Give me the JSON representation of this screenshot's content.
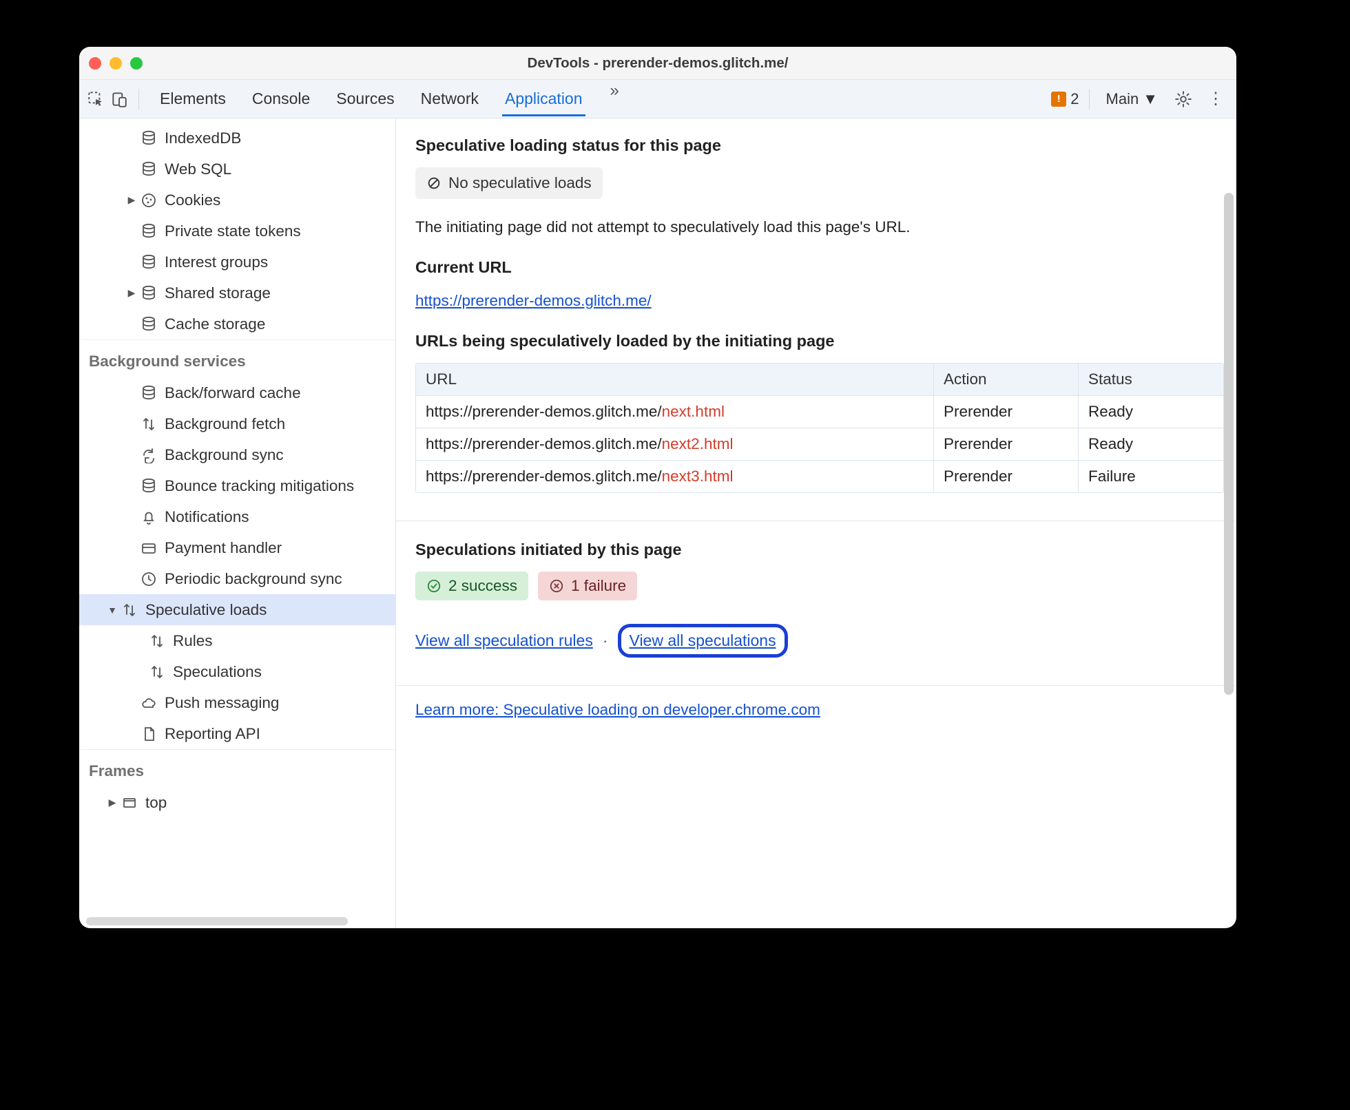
{
  "window": {
    "title": "DevTools - prerender-demos.glitch.me/"
  },
  "toolbar": {
    "tabs": [
      "Elements",
      "Console",
      "Sources",
      "Network",
      "Application"
    ],
    "active_tab_index": 4,
    "warning_count": "2",
    "target_label": "Main"
  },
  "sidebar": {
    "storage_items": [
      {
        "key": "indexeddb",
        "label": "IndexedDB",
        "icon": "db",
        "arrow": ""
      },
      {
        "key": "websql",
        "label": "Web SQL",
        "icon": "db",
        "arrow": ""
      },
      {
        "key": "cookies",
        "label": "Cookies",
        "icon": "cookie",
        "arrow": "▶"
      },
      {
        "key": "pst",
        "label": "Private state tokens",
        "icon": "db",
        "arrow": ""
      },
      {
        "key": "interest",
        "label": "Interest groups",
        "icon": "db",
        "arrow": ""
      },
      {
        "key": "shared",
        "label": "Shared storage",
        "icon": "db",
        "arrow": "▶"
      },
      {
        "key": "cache",
        "label": "Cache storage",
        "icon": "db",
        "arrow": ""
      }
    ],
    "bg_head": "Background services",
    "bg_items": [
      {
        "key": "bfcache",
        "label": "Back/forward cache",
        "icon": "db"
      },
      {
        "key": "bgfetch",
        "label": "Background fetch",
        "icon": "updown"
      },
      {
        "key": "bgsync",
        "label": "Background sync",
        "icon": "sync"
      },
      {
        "key": "bounce",
        "label": "Bounce tracking mitigations",
        "icon": "db"
      },
      {
        "key": "notif",
        "label": "Notifications",
        "icon": "bell"
      },
      {
        "key": "payment",
        "label": "Payment handler",
        "icon": "card"
      },
      {
        "key": "periodic",
        "label": "Periodic background sync",
        "icon": "clock"
      }
    ],
    "spec": {
      "label": "Speculative loads",
      "children": [
        {
          "key": "rules",
          "label": "Rules"
        },
        {
          "key": "specs",
          "label": "Speculations"
        }
      ]
    },
    "bg_tail": [
      {
        "key": "push",
        "label": "Push messaging",
        "icon": "cloud"
      },
      {
        "key": "report",
        "label": "Reporting API",
        "icon": "doc"
      }
    ],
    "frames_head": "Frames",
    "frames_items": [
      {
        "key": "top",
        "label": "top",
        "icon": "frame",
        "arrow": "▶"
      }
    ]
  },
  "main": {
    "status_heading": "Speculative loading status for this page",
    "status_chip": "No speculative loads",
    "status_para": "The initiating page did not attempt to speculatively load this page's URL.",
    "current_url_heading": "Current URL",
    "current_url": "https://prerender-demos.glitch.me/",
    "urls_heading": "URLs being speculatively loaded by the initiating page",
    "table": {
      "headers": [
        "URL",
        "Action",
        "Status"
      ],
      "rows": [
        {
          "url_a": "https://prerender-demos.glitch.me/",
          "url_b": "next.html",
          "action": "Prerender",
          "status": "Ready"
        },
        {
          "url_a": "https://prerender-demos.glitch.me/",
          "url_b": "next2.html",
          "action": "Prerender",
          "status": "Ready"
        },
        {
          "url_a": "https://prerender-demos.glitch.me/",
          "url_b": "next3.html",
          "action": "Prerender",
          "status": "Failure"
        }
      ]
    },
    "speculations_heading": "Speculations initiated by this page",
    "success_chip": "2 success",
    "failure_chip": "1 failure",
    "link_rules": "View all speculation rules",
    "link_specs": "View all speculations",
    "learn_more": "Learn more: Speculative loading on developer.chrome.com"
  }
}
